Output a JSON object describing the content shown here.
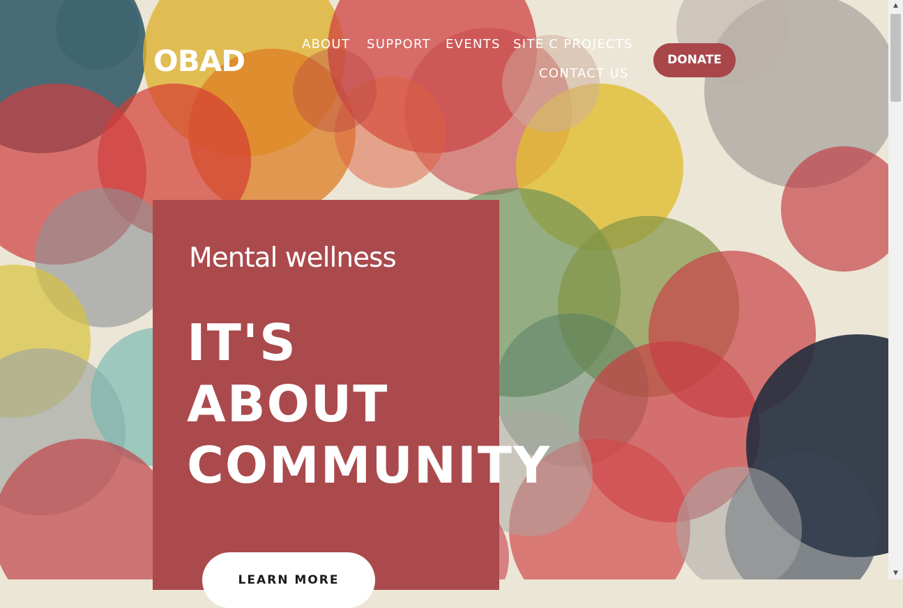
{
  "header": {
    "logo": "OBAD",
    "nav": [
      {
        "label": "ABOUT"
      },
      {
        "label": "SUPPORT"
      },
      {
        "label": "EVENTS"
      },
      {
        "label": "SITE C PROJECTS"
      },
      {
        "label": "CONTACT US"
      }
    ],
    "donate_label": "DONATE"
  },
  "hero": {
    "kicker": "Mental wellness",
    "headline_lines": [
      "IT'S",
      "ABOUT",
      "COMMUNITY"
    ],
    "cta_label": "LEARN MORE"
  },
  "colors": {
    "accent": "#aa4a4d",
    "button_text": "#1a1a1a",
    "background": "#ece6d6"
  }
}
